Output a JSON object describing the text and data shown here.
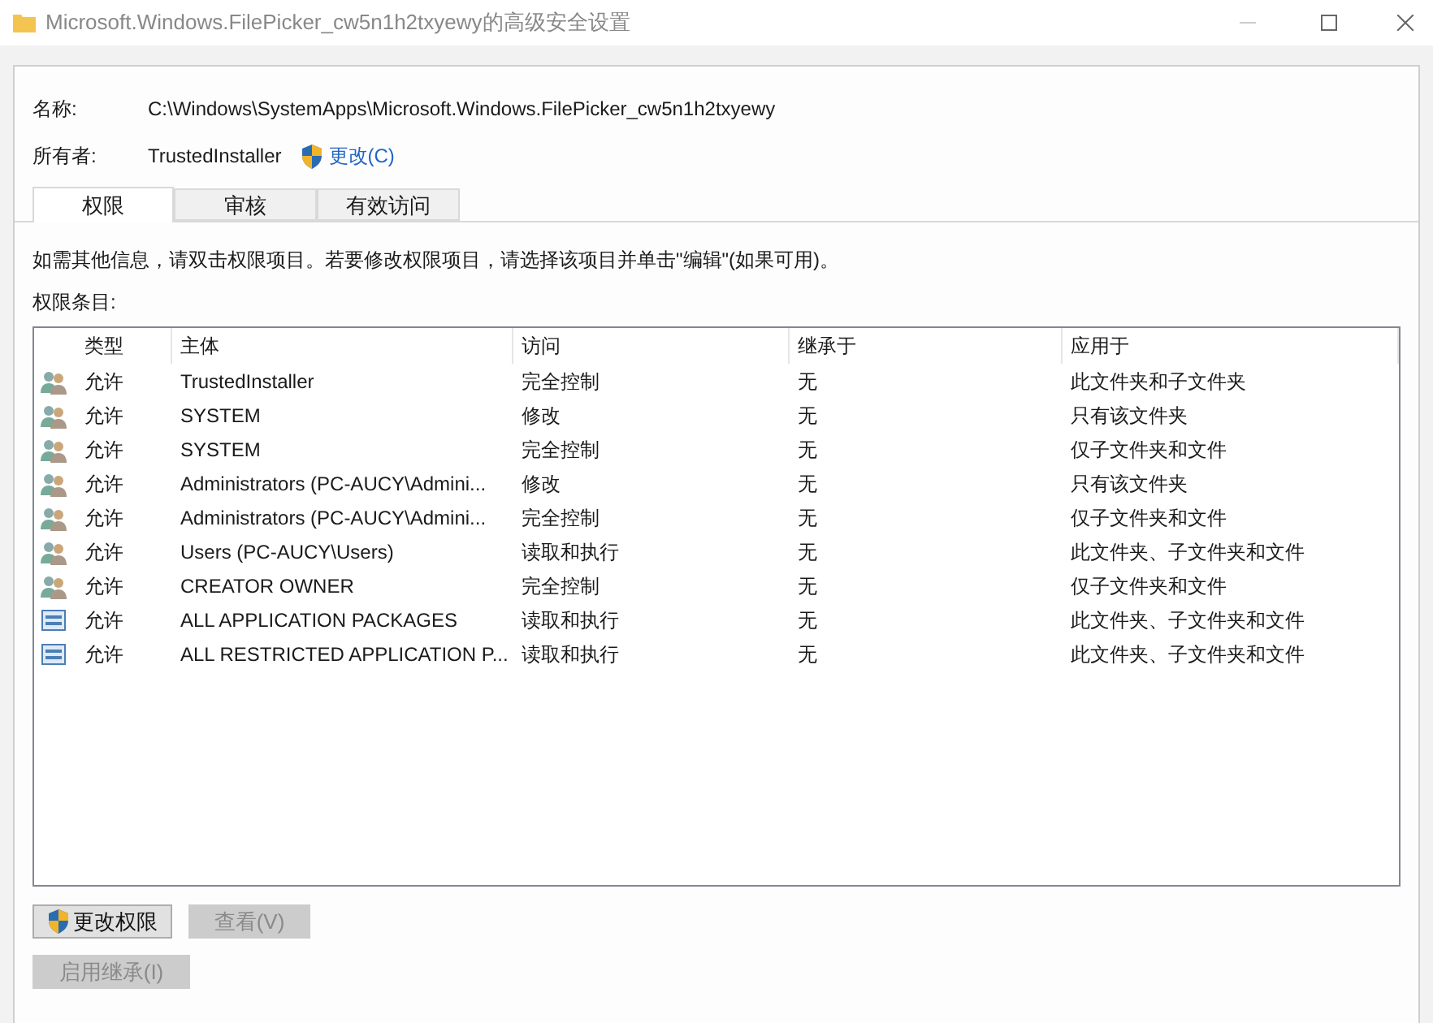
{
  "window": {
    "title": "Microsoft.Windows.FilePicker_cw5n1h2txyewy的高级安全设置"
  },
  "name_label": "名称:",
  "name_value": "C:\\Windows\\SystemApps\\Microsoft.Windows.FilePicker_cw5n1h2txyewy",
  "owner_label": "所有者:",
  "owner_value": "TrustedInstaller",
  "owner_change_link": "更改(C)",
  "tabs": [
    {
      "label": "权限",
      "selected": true
    },
    {
      "label": "审核",
      "selected": false
    },
    {
      "label": "有效访问",
      "selected": false
    }
  ],
  "info_text": "如需其他信息，请双击权限项目。若要修改权限项目，请选择该项目并单击\"编辑\"(如果可用)。",
  "entries_label": "权限条目:",
  "table": {
    "columns": [
      "类型",
      "主体",
      "访问",
      "继承于",
      "应用于"
    ],
    "rows": [
      {
        "kind": "user",
        "cells": [
          "允许",
          "TrustedInstaller",
          "完全控制",
          "无",
          "此文件夹和子文件夹"
        ]
      },
      {
        "kind": "user",
        "cells": [
          "允许",
          "SYSTEM",
          "修改",
          "无",
          "只有该文件夹"
        ]
      },
      {
        "kind": "user",
        "cells": [
          "允许",
          "SYSTEM",
          "完全控制",
          "无",
          "仅子文件夹和文件"
        ]
      },
      {
        "kind": "user",
        "cells": [
          "允许",
          "Administrators (PC-AUCY\\Admini...",
          "修改",
          "无",
          "只有该文件夹"
        ]
      },
      {
        "kind": "user",
        "cells": [
          "允许",
          "Administrators (PC-AUCY\\Admini...",
          "完全控制",
          "无",
          "仅子文件夹和文件"
        ]
      },
      {
        "kind": "user",
        "cells": [
          "允许",
          "Users (PC-AUCY\\Users)",
          "读取和执行",
          "无",
          "此文件夹、子文件夹和文件"
        ]
      },
      {
        "kind": "user",
        "cells": [
          "允许",
          "CREATOR OWNER",
          "完全控制",
          "无",
          "仅子文件夹和文件"
        ]
      },
      {
        "kind": "package",
        "cells": [
          "允许",
          "ALL APPLICATION PACKAGES",
          "读取和执行",
          "无",
          "此文件夹、子文件夹和文件"
        ]
      },
      {
        "kind": "package",
        "cells": [
          "允许",
          "ALL RESTRICTED APPLICATION P...",
          "读取和执行",
          "无",
          "此文件夹、子文件夹和文件"
        ]
      }
    ]
  },
  "buttons": [
    {
      "label": "更改权限",
      "shield": true,
      "disabled": false
    },
    {
      "label": "查看(V)",
      "shield": false,
      "disabled": true
    }
  ],
  "inherit_button": {
    "label": "启用继承(I)",
    "disabled": true
  }
}
